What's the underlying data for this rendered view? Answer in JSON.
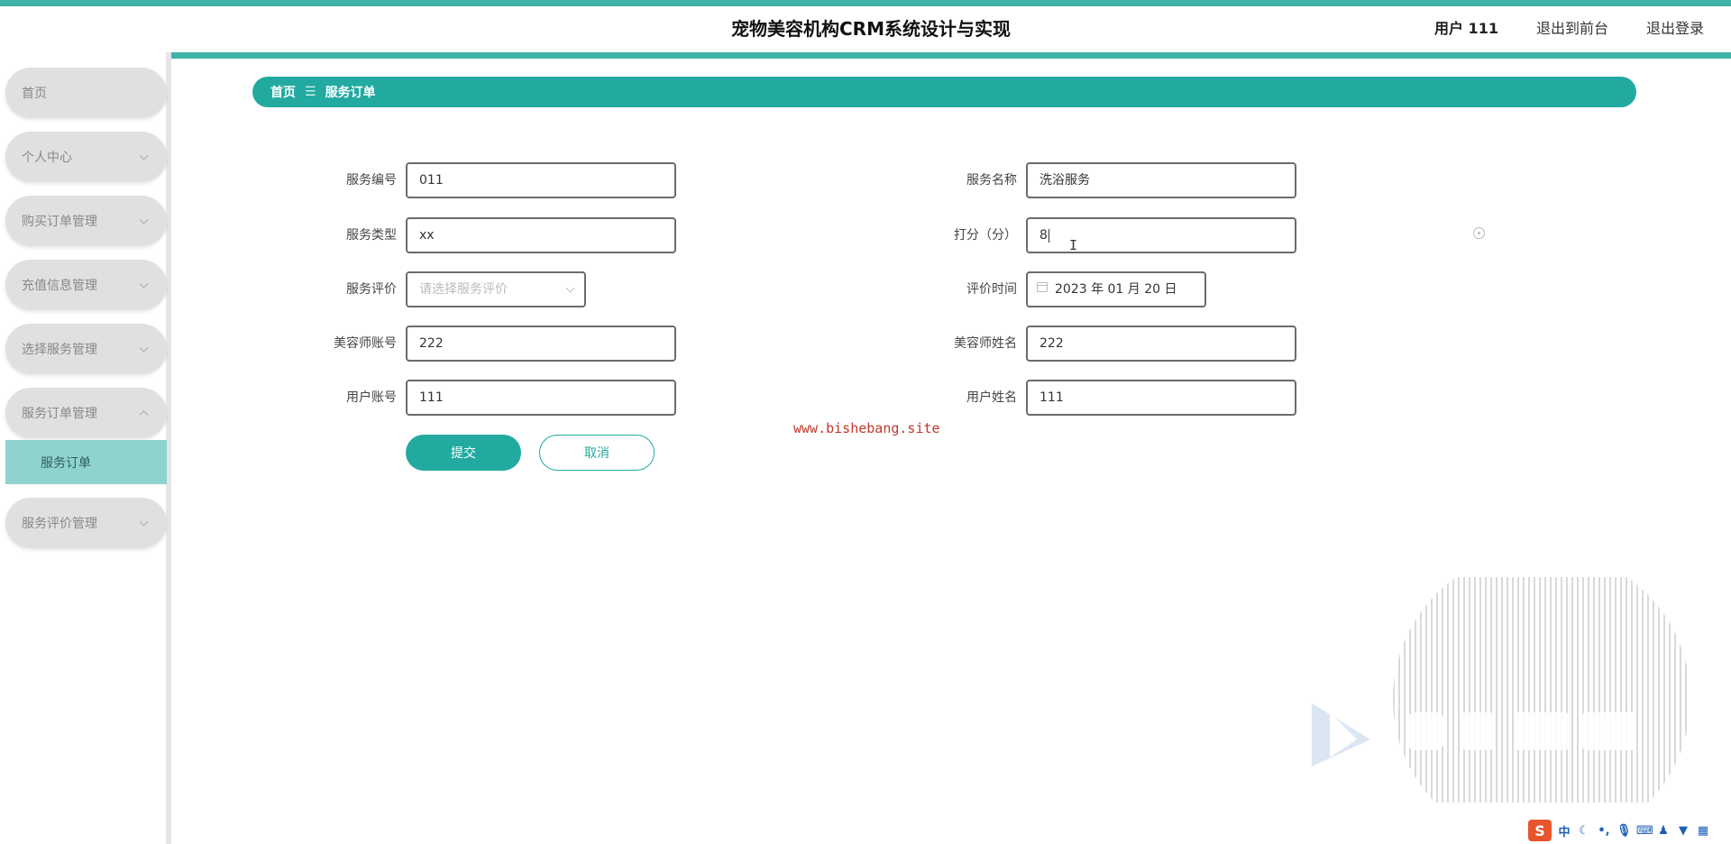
{
  "app": {
    "title": "宠物美容机构CRM系统设计与实现"
  },
  "header": {
    "user_label": "用户 111",
    "back_to_front": "退出到前台",
    "logout": "退出登录"
  },
  "sidebar": {
    "items": [
      {
        "label": "首页"
      },
      {
        "label": "个人中心"
      },
      {
        "label": "购买订单管理"
      },
      {
        "label": "充值信息管理"
      },
      {
        "label": "选择服务管理"
      },
      {
        "label": "服务订单管理"
      },
      {
        "label": "服务评价管理"
      }
    ],
    "active_sub": "服务订单"
  },
  "breadcrumb": {
    "home": "首页",
    "separator": "☰",
    "current": "服务订单"
  },
  "form": {
    "service_no": {
      "label": "服务编号",
      "value": "011"
    },
    "service_name": {
      "label": "服务名称",
      "value": "洗浴服务"
    },
    "service_type": {
      "label": "服务类型",
      "value": "xx"
    },
    "score": {
      "label": "打分（分）",
      "value": "8"
    },
    "service_eval": {
      "label": "服务评价",
      "placeholder": "请选择服务评价"
    },
    "eval_time": {
      "label": "评价时间",
      "value": "2023 年 01 月 20 日"
    },
    "groomer_account": {
      "label": "美容师账号",
      "value": "222"
    },
    "groomer_name": {
      "label": "美容师姓名",
      "value": "222"
    },
    "user_account": {
      "label": "用户账号",
      "value": "111"
    },
    "user_name": {
      "label": "用户姓名",
      "value": "111"
    },
    "submit": "提交",
    "cancel": "取消"
  },
  "watermark": {
    "url": "www.bishebang.site"
  },
  "ime": {
    "logo": "S",
    "lang": "中",
    "icons": [
      "moon-icon",
      "punctuation-icon",
      "mic-icon",
      "keyboard-icon",
      "user-icon",
      "shirt-icon",
      "grid-icon"
    ]
  },
  "colors": {
    "accent": "#22aaa1",
    "stripe": "#3fb3a8",
    "sidebar_item": "#e0e0e0",
    "sidebar_active_sub": "#8fd3cf",
    "watermark_url": "#c0392b"
  }
}
